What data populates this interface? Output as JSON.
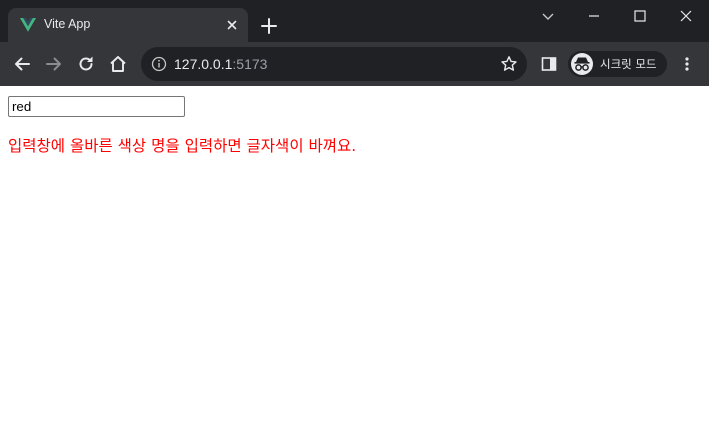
{
  "browser": {
    "tab": {
      "title": "Vite App",
      "favicon": "vue-logo-icon"
    },
    "url": {
      "host": "127.0.0.1",
      "port": ":5173"
    },
    "profile": {
      "label": "시크릿 모드",
      "icon": "incognito-icon"
    },
    "colors": {
      "tabstrip": "#202124",
      "toolbar": "#35363a",
      "vue_green": "#41b883"
    }
  },
  "page": {
    "input": {
      "value": "red"
    },
    "message": {
      "text": "입력창에 올바른 색상 명을 입력하면 글자색이 바껴요.",
      "color": "red"
    }
  }
}
